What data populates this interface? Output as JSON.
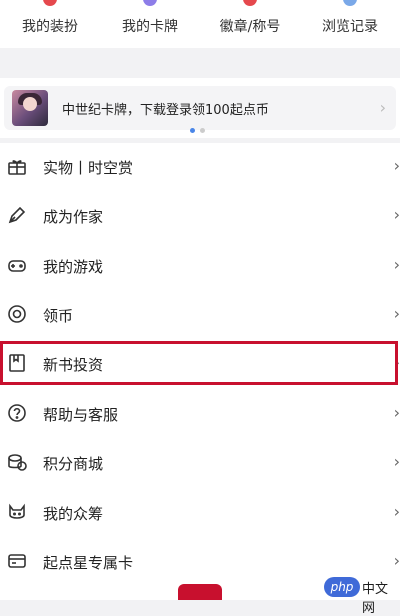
{
  "top_menu": [
    {
      "label": "我的装扮",
      "color": "#e5484d"
    },
    {
      "label": "我的卡牌",
      "color": "#8d7de8"
    },
    {
      "label": "徽章/称号",
      "color": "#e5484d"
    },
    {
      "label": "浏览记录",
      "color": "#7aa8e8"
    }
  ],
  "banner": {
    "text": "中世纪卡牌，下载登录领100起点币",
    "chevron": "›",
    "page_count": 2,
    "active_page": 1
  },
  "menu": [
    {
      "label": "实物丨时空赏",
      "icon": "gift-icon",
      "chevron": "›"
    },
    {
      "label": "成为作家",
      "icon": "pen-icon",
      "chevron": "›"
    },
    {
      "label": "我的游戏",
      "icon": "gamepad-icon",
      "chevron": "›"
    },
    {
      "label": "领币",
      "icon": "coin-icon",
      "chevron": "›"
    },
    {
      "label": "新书投资",
      "icon": "bookmark-icon",
      "chevron": "›"
    },
    {
      "label": "帮助与客服",
      "icon": "help-icon",
      "chevron": "›"
    },
    {
      "label": "积分商城",
      "icon": "points-icon",
      "chevron": "›"
    },
    {
      "label": "我的众筹",
      "icon": "cat-icon",
      "chevron": "›"
    },
    {
      "label": "起点星专属卡",
      "icon": "card-icon",
      "chevron": "›"
    }
  ],
  "highlighted_item": "新书投资",
  "watermark": {
    "logo": "php",
    "text": "中文网"
  },
  "colors": {
    "accent": "#c8102e",
    "pager_active": "#4a86e8",
    "pager_inactive": "#cccccc"
  }
}
